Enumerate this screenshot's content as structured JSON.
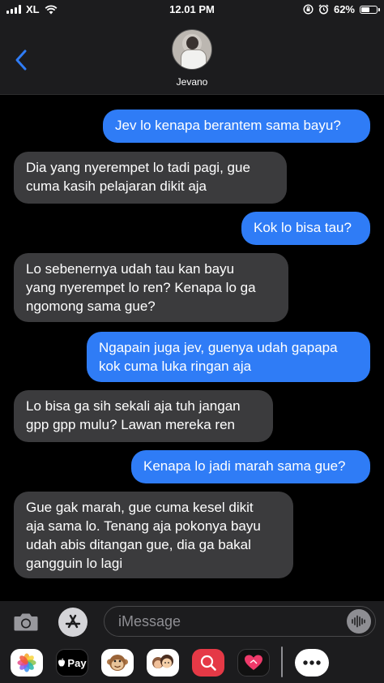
{
  "status_bar": {
    "carrier": "XL",
    "time": "12.01 PM",
    "battery": "62%",
    "battery_level": 0.62
  },
  "header": {
    "contact_name": "Jevano",
    "back_icon": "chevron-left-icon"
  },
  "messages": [
    {
      "direction": "sent",
      "text": "Jev lo kenapa berantem sama bayu?"
    },
    {
      "direction": "received",
      "text": "Dia yang nyerempet lo tadi pagi, gue\ncuma kasih pelajaran dikit aja"
    },
    {
      "direction": "sent",
      "text": "Kok lo bisa tau?"
    },
    {
      "direction": "received",
      "text": "Lo sebenernya udah tau kan bayu\nyang nyerempet lo ren? Kenapa lo ga\nngomong sama gue?"
    },
    {
      "direction": "sent",
      "text": "Ngapain juga jev, guenya udah gapapa\nkok cuma luka ringan aja"
    },
    {
      "direction": "received",
      "text": "Lo bisa ga sih sekali aja tuh jangan\ngpp gpp mulu? Lawan mereka ren"
    },
    {
      "direction": "sent",
      "text": "Kenapa lo jadi marah sama gue?"
    },
    {
      "direction": "received",
      "text": "Gue gak marah, gue cuma kesel dikit\naja sama lo. Tenang aja pokonya bayu\nudah abis ditangan gue, dia ga bakal\ngangguin lo lagi"
    }
  ],
  "input": {
    "placeholder": "iMessage",
    "value": ""
  },
  "app_drawer": [
    {
      "name": "photos-icon"
    },
    {
      "name": "apple-pay-icon",
      "label": "Pay"
    },
    {
      "name": "animoji-monkey-icon"
    },
    {
      "name": "memoji-icon"
    },
    {
      "name": "search-images-icon"
    },
    {
      "name": "digital-touch-icon"
    },
    {
      "name": "more-icon"
    }
  ],
  "colors": {
    "sent_bubble": "#2f7cf6",
    "received_bubble": "#3b3b3d",
    "accent": "#2f7cf6",
    "background": "#000000"
  }
}
